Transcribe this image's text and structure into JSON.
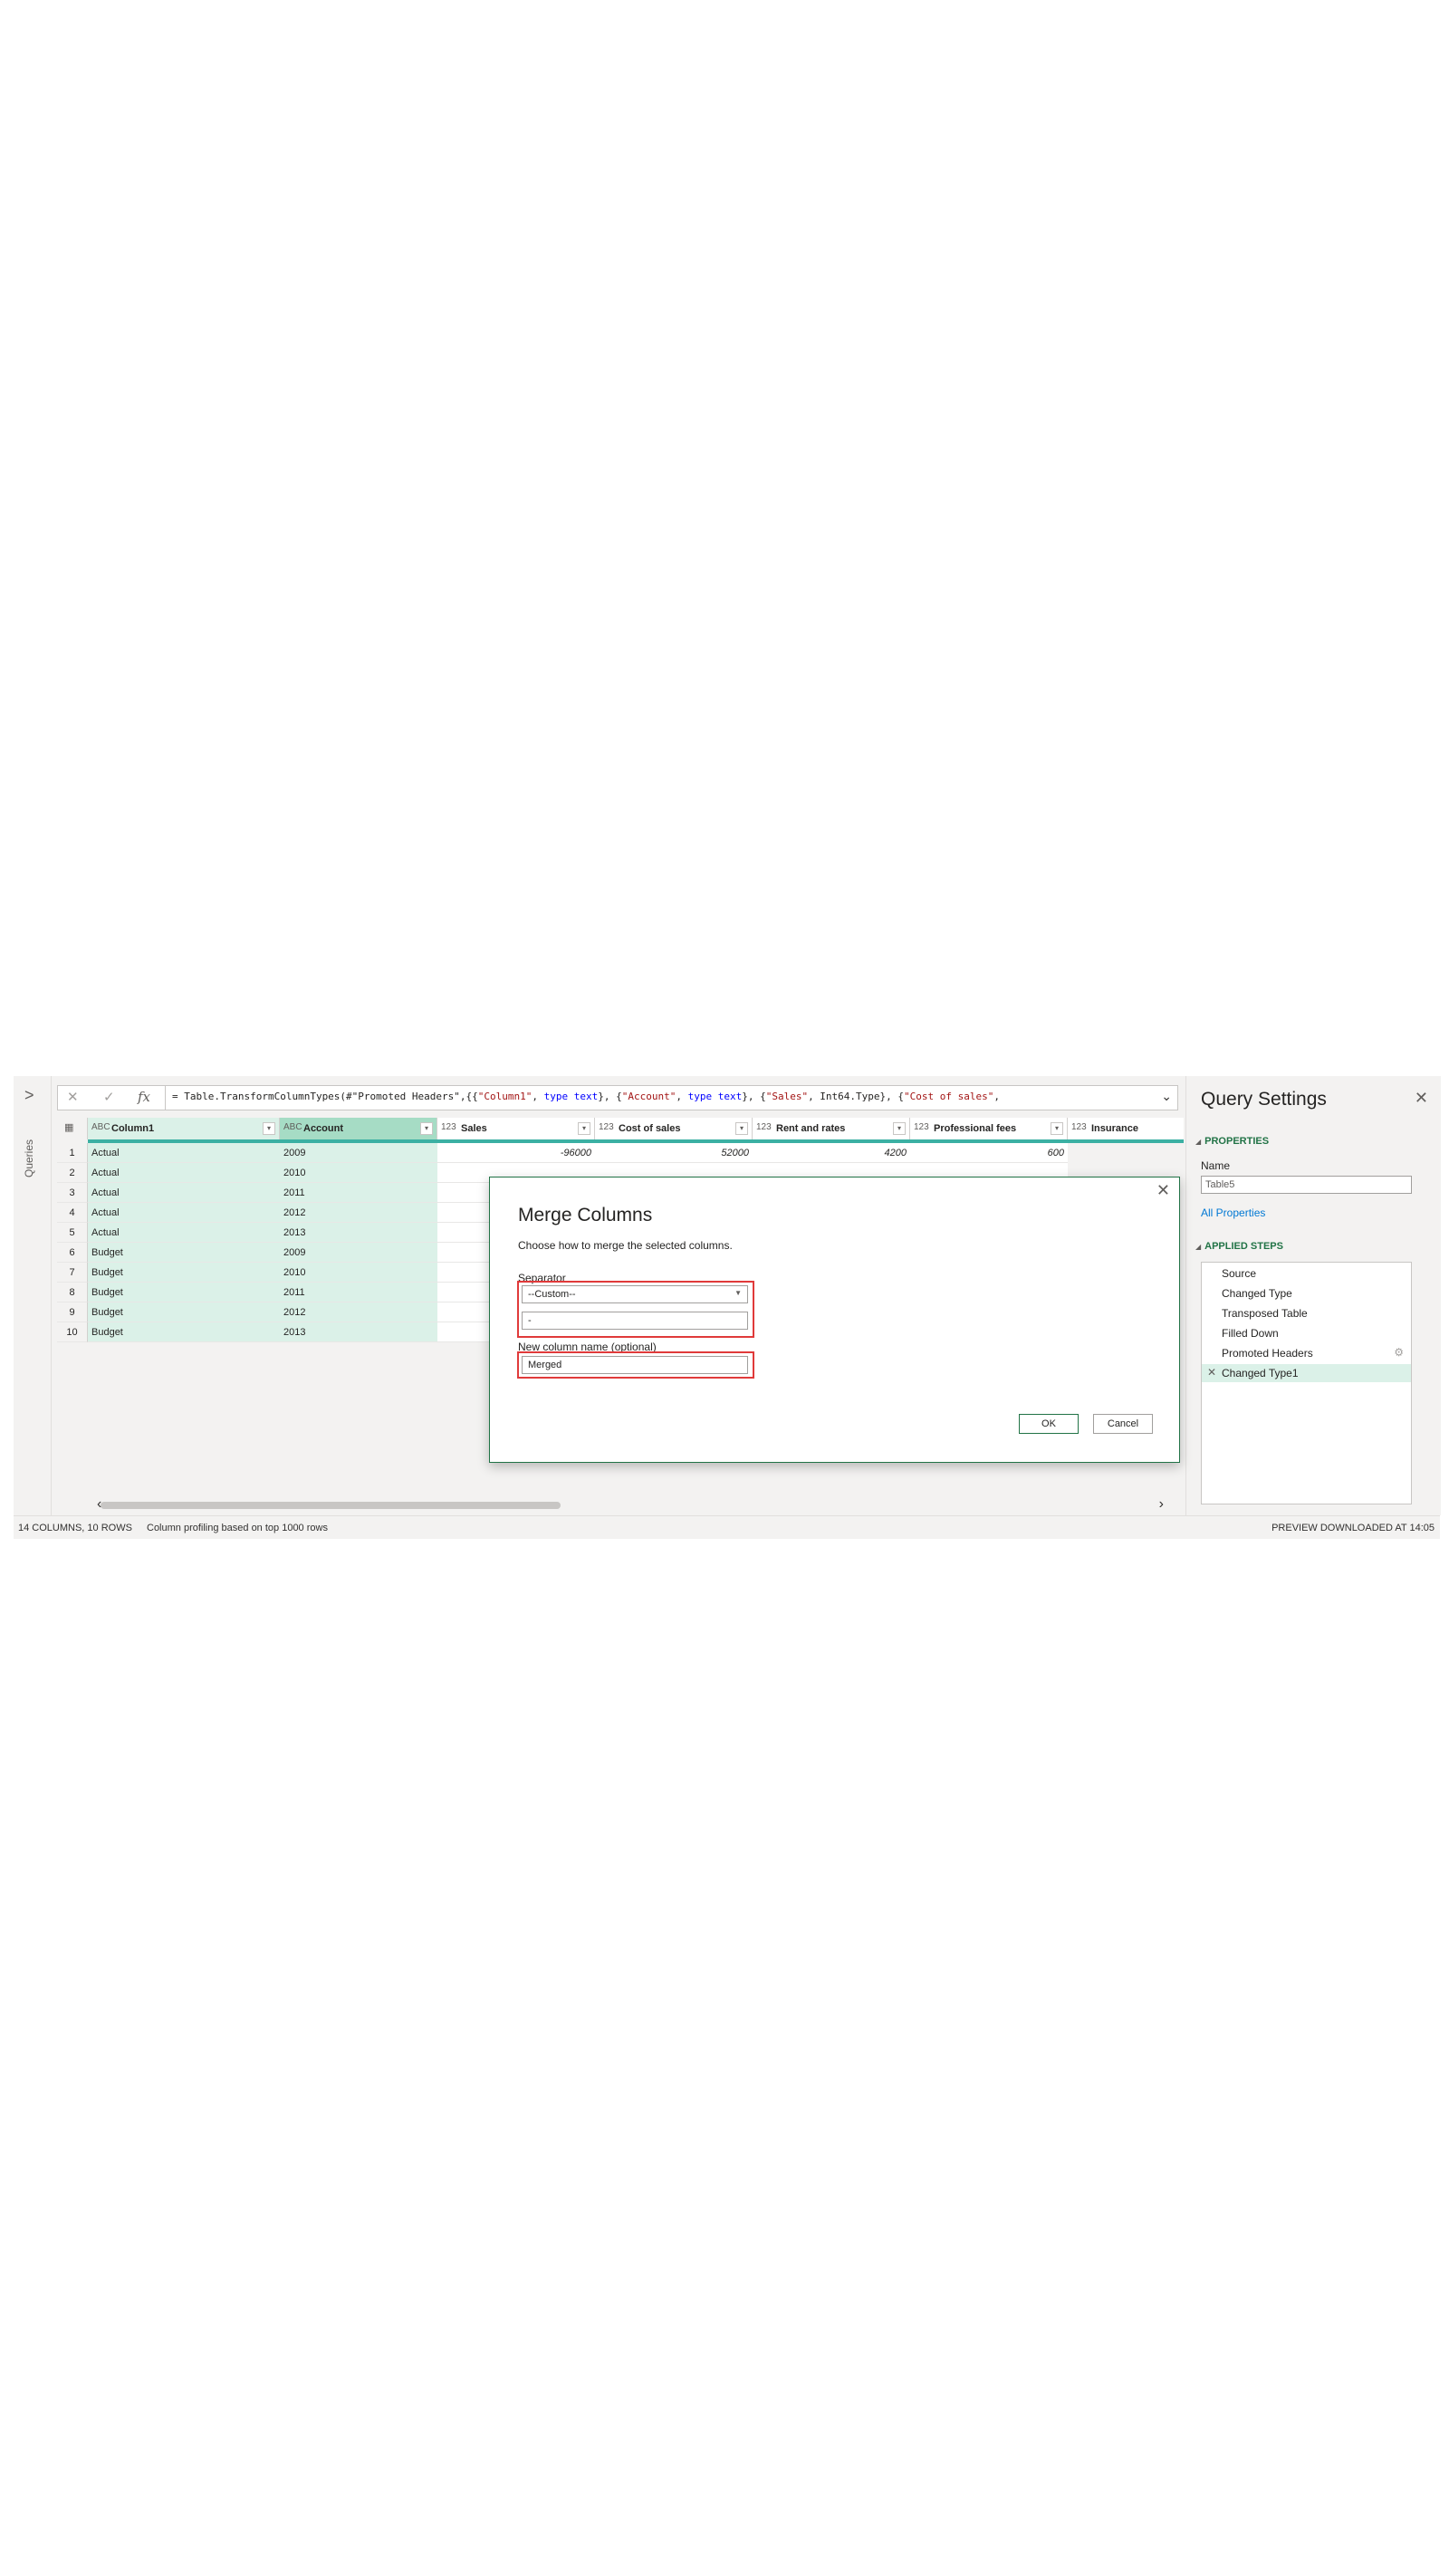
{
  "queries_pane": {
    "expand_glyph": ">",
    "label": "Queries"
  },
  "formula_bar": {
    "prefix": "= Table.TransformColumnTypes(#\"Promoted Headers\",{{",
    "s1": "\"Column1\"",
    "p1": ", ",
    "k1": "type text",
    "p2": "}, {",
    "s2": "\"Account\"",
    "p3": ", ",
    "k2": "type text",
    "p4": "}, {",
    "s3": "\"Sales\"",
    "p5": ", Int64.Type}, {",
    "s4": "\"Cost of sales\"",
    "p6": ","
  },
  "columns": [
    {
      "type": "ABC",
      "name": "Column1"
    },
    {
      "type": "ABC",
      "name": "Account"
    },
    {
      "type": "123",
      "name": "Sales"
    },
    {
      "type": "123",
      "name": "Cost of sales"
    },
    {
      "type": "123",
      "name": "Rent and rates"
    },
    {
      "type": "123",
      "name": "Professional fees"
    },
    {
      "type": "123",
      "name": "Insurance"
    }
  ],
  "rows": [
    {
      "n": "1",
      "c1": "Actual",
      "c2": "2009",
      "c3": "-96000",
      "c4": "52000",
      "c5": "4200",
      "c6": "600"
    },
    {
      "n": "2",
      "c1": "Actual",
      "c2": "2010",
      "c3": "",
      "c4": "",
      "c5": "",
      "c6": ""
    },
    {
      "n": "3",
      "c1": "Actual",
      "c2": "2011",
      "c3": "",
      "c4": "",
      "c5": "",
      "c6": ""
    },
    {
      "n": "4",
      "c1": "Actual",
      "c2": "2012",
      "c3": "",
      "c4": "",
      "c5": "",
      "c6": ""
    },
    {
      "n": "5",
      "c1": "Actual",
      "c2": "2013",
      "c3": "",
      "c4": "",
      "c5": "",
      "c6": ""
    },
    {
      "n": "6",
      "c1": "Budget",
      "c2": "2009",
      "c3": "",
      "c4": "",
      "c5": "",
      "c6": ""
    },
    {
      "n": "7",
      "c1": "Budget",
      "c2": "2010",
      "c3": "",
      "c4": "",
      "c5": "",
      "c6": ""
    },
    {
      "n": "8",
      "c1": "Budget",
      "c2": "2011",
      "c3": "",
      "c4": "",
      "c5": "",
      "c6": ""
    },
    {
      "n": "9",
      "c1": "Budget",
      "c2": "2012",
      "c3": "",
      "c4": "",
      "c5": "",
      "c6": ""
    },
    {
      "n": "10",
      "c1": "Budget",
      "c2": "2013",
      "c3": "",
      "c4": "",
      "c5": "",
      "c6": ""
    }
  ],
  "query_settings": {
    "title": "Query Settings",
    "properties_header": "PROPERTIES",
    "name_label": "Name",
    "name_value": "Table5",
    "all_properties": "All Properties",
    "applied_steps_header": "APPLIED STEPS",
    "steps": [
      "Source",
      "Changed Type",
      "Transposed Table",
      "Filled Down",
      "Promoted Headers",
      "Changed Type1"
    ]
  },
  "status_bar": {
    "columns_rows": "14 COLUMNS, 10 ROWS",
    "profiling": "Column profiling based on top 1000 rows",
    "preview": "PREVIEW DOWNLOADED AT 14:05"
  },
  "dialog": {
    "title": "Merge Columns",
    "subtitle": "Choose how to merge the selected columns.",
    "separator_label": "Separator",
    "separator_selected": "--Custom--",
    "custom_separator_value": "-",
    "new_column_label": "New column name (optional)",
    "new_column_value": "Merged",
    "ok": "OK",
    "cancel": "Cancel"
  },
  "colors": {
    "accent": "#217346",
    "teal": "#3bb0a3",
    "selected_fill": "#dbf1e8",
    "highlight_box": "#e03a3a"
  }
}
